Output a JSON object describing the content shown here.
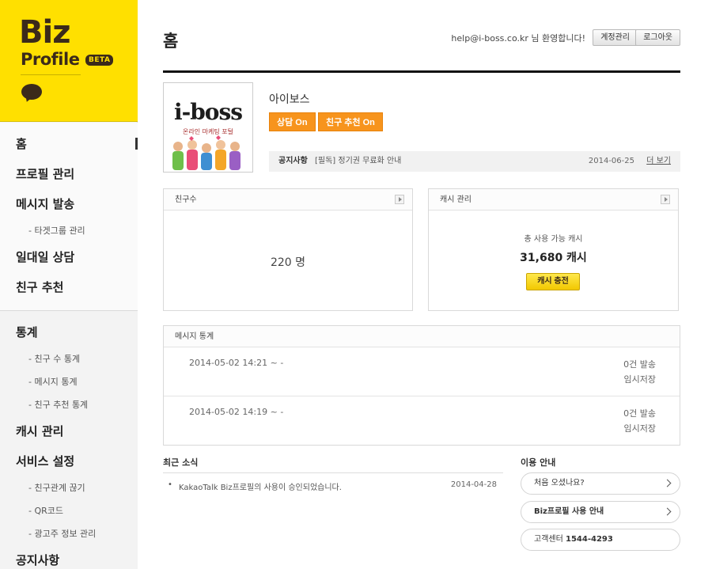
{
  "logo": {
    "line1": "Biz",
    "line2": "Profile",
    "badge": "BETA"
  },
  "nav": {
    "home": "홈",
    "profile": "프로필 관리",
    "message": "메시지 발송",
    "target_group": "- 타겟그룹 관리",
    "one_to_one": "일대일 상담",
    "friend_recommend": "친구 추천",
    "stats": "통계",
    "stats_friends": "- 친구 수 통계",
    "stats_message": "- 메시지 통계",
    "stats_recommend": "- 친구 추천 통계",
    "cash": "캐시 관리",
    "service": "서비스 설정",
    "unfriend": "- 친구관계 끊기",
    "qrcode": "- QR코드",
    "advertiser": "- 광고주 정보 관리",
    "notice": "공지사항"
  },
  "header": {
    "title": "홈",
    "welcome": "help@i-boss.co.kr 님 환영합니다!",
    "account_btn": "계정관리",
    "logout_btn": "로그아웃"
  },
  "profile": {
    "logo_text": "i-boss",
    "logo_sub": "온라인 마케팅 포털",
    "name": "아이보스",
    "consult_btn": "상담 On",
    "recommend_btn": "친구 추천 On"
  },
  "notice": {
    "label": "공지사항",
    "text": "[필독] 정기권 무료화 안내",
    "date": "2014-06-25",
    "more": "더 보기"
  },
  "friends_box": {
    "title": "친구수",
    "count": "220 명"
  },
  "cash_box": {
    "title": "캐시 관리",
    "label": "총 사용 가능 캐시",
    "amount": "31,680 캐시",
    "charge_btn": "캐시 충전"
  },
  "message_stats": {
    "title": "메시지 통계",
    "rows": [
      {
        "datetime": "2014-05-02 14:21 ~ -",
        "count": "0건 발송",
        "status": "임시저장"
      },
      {
        "datetime": "2014-05-02 14:19 ~ -",
        "count": "0건 발송",
        "status": "임시저장"
      }
    ]
  },
  "news": {
    "title": "최근 소식",
    "bullet": "•",
    "item_text": "KakaoTalk Biz프로필의 사용이 승인되었습니다.",
    "item_date": "2014-04-28"
  },
  "guide": {
    "title": "이용 안내",
    "first": "처음 오셨나요?",
    "usage": "Biz프로필 사용 안내",
    "center_label": "고객센터",
    "center_number": "1544-4293"
  }
}
